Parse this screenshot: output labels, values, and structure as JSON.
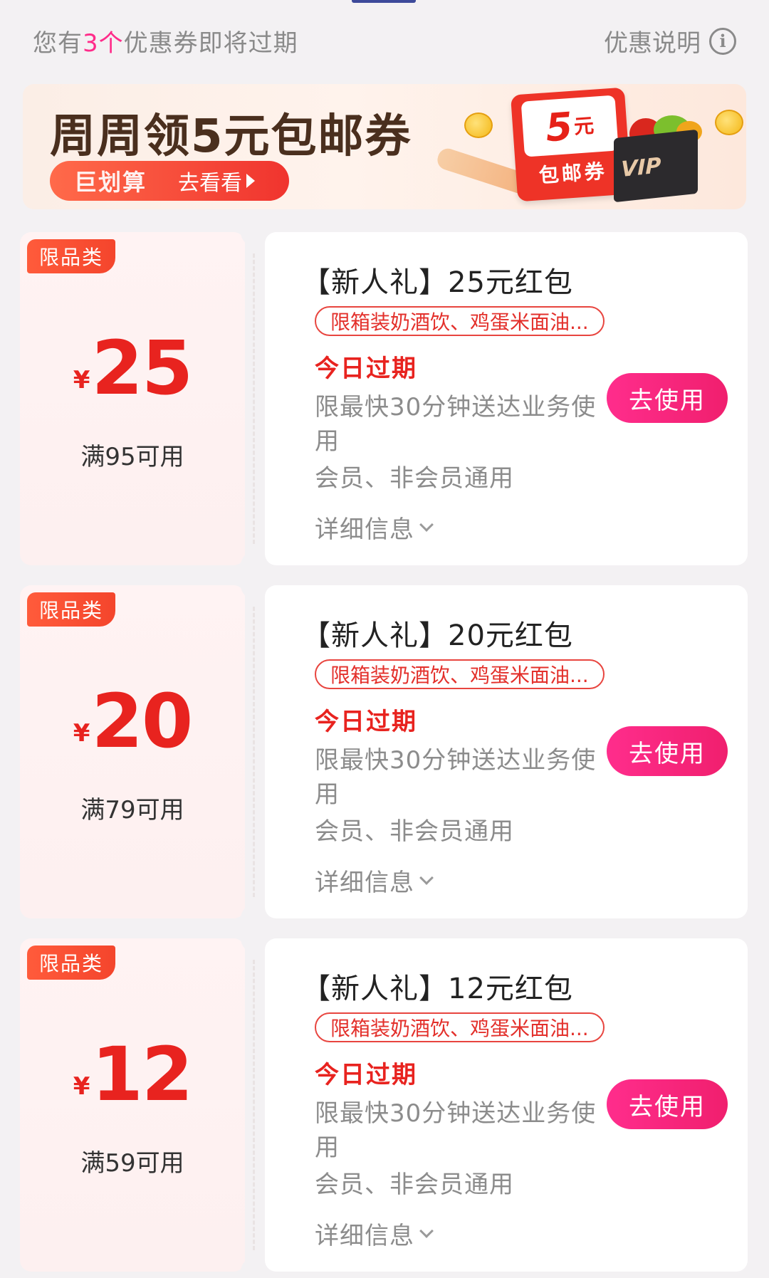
{
  "header": {
    "notice_prefix": "您有",
    "notice_count": "3个",
    "notice_suffix": "优惠券即将过期",
    "info_label": "优惠说明",
    "info_icon": "info-icon"
  },
  "banner": {
    "title": "周周领5元包邮券",
    "brand": "巨划算",
    "cta": "去看看",
    "coupon_value": "5",
    "coupon_unit": "元",
    "coupon_label": "包邮券",
    "vip_label": "VIP"
  },
  "coupons": [
    {
      "badge": "限品类",
      "currency": "¥",
      "amount": "25",
      "threshold": "满95可用",
      "title": "【新人礼】25元红包",
      "scope": "限箱装奶酒饮、鸡蛋米面油...",
      "expire": "今日过期",
      "desc1": "限最快30分钟送达业务使用",
      "desc2": "会员、非会员通用",
      "detail": "详细信息",
      "button": "去使用"
    },
    {
      "badge": "限品类",
      "currency": "¥",
      "amount": "20",
      "threshold": "满79可用",
      "title": "【新人礼】20元红包",
      "scope": "限箱装奶酒饮、鸡蛋米面油...",
      "expire": "今日过期",
      "desc1": "限最快30分钟送达业务使用",
      "desc2": "会员、非会员通用",
      "detail": "详细信息",
      "button": "去使用"
    },
    {
      "badge": "限品类",
      "currency": "¥",
      "amount": "12",
      "threshold": "满59可用",
      "title": "【新人礼】12元红包",
      "scope": "限箱装奶酒饮、鸡蛋米面油...",
      "expire": "今日过期",
      "desc1": "限最快30分钟送达业务使用",
      "desc2": "会员、非会员通用",
      "detail": "详细信息",
      "button": "去使用"
    }
  ],
  "colors": {
    "accent_pink": "#ff2d8c",
    "price_red": "#e8231f",
    "badge_orange": "#ff5b3b"
  }
}
